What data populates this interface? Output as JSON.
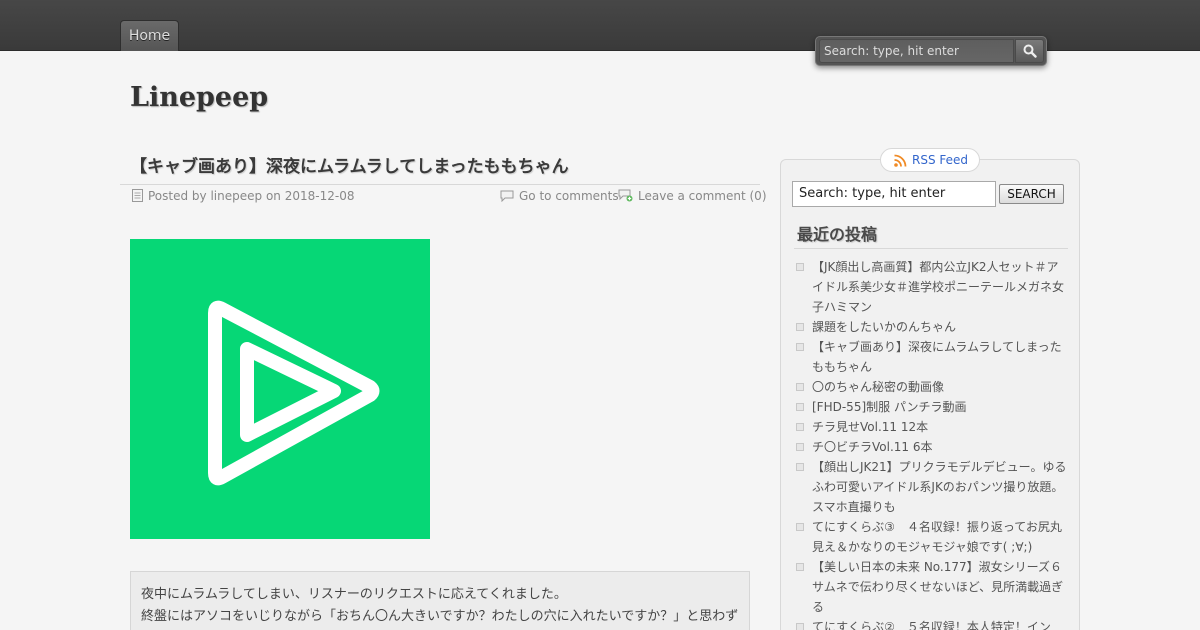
{
  "nav": {
    "home_label": "Home"
  },
  "top_search": {
    "placeholder": "Search: type, hit enter"
  },
  "site": {
    "title": "Linepeep"
  },
  "post": {
    "title": "【キャブ画あり】深夜にムラムラしてしまったももちゃん",
    "posted_prefix": "Posted by",
    "author": "linepeep",
    "on_word": "on",
    "date": "2018-12-08",
    "go_to_comments": "Go to comments",
    "leave_comment": "Leave a comment (0)",
    "excerpt_lines": [
      "夜中にムラムラしてしまい、リスナーのリクエストに応えてくれました。",
      "終盤にはアソコをいじりながら「おちん〇ん大きいですか？わたしの穴に入れたいですか？」と思わず"
    ]
  },
  "sidebar": {
    "rss_label": "RSS Feed",
    "search_value": "Search: type, hit enter",
    "search_button": "SEARCH",
    "recent_title": "最近の投稿",
    "recent_posts": [
      "【JK顔出し高画質】都内公立JK2人セット＃アイドル系美少女＃進学校ポニーテールメガネ女子ハミマン",
      "課題をしたいかのんちゃん",
      "【キャブ画あり】深夜にムラムラしてしまったももちゃん",
      "〇のちゃん秘密の動画像",
      "[FHD-55]制服 パンチラ動画",
      "チラ見せVol.11 12本",
      "チ〇ビチラVol.11 6本",
      "【顔出しJK21】プリクラモデルデビュー。ゆるふわ可愛いアイドル系JKのおパンツ撮り放題。スマホ直撮りも",
      "てにすくらぶ③　４名収録！振り返ってお尻丸見え＆かなりのモジャモジャ娘です( ;∀;)",
      "【美しい日本の未来 No.177】淑女シリーズ６　サムネで伝わり尽くせないほど、見所満載過ぎる",
      "てにすくらぶ②　５名収録！本人特定！イン"
    ]
  },
  "colors": {
    "thumbnail_bg": "#06d776",
    "link": "#3366cc"
  }
}
